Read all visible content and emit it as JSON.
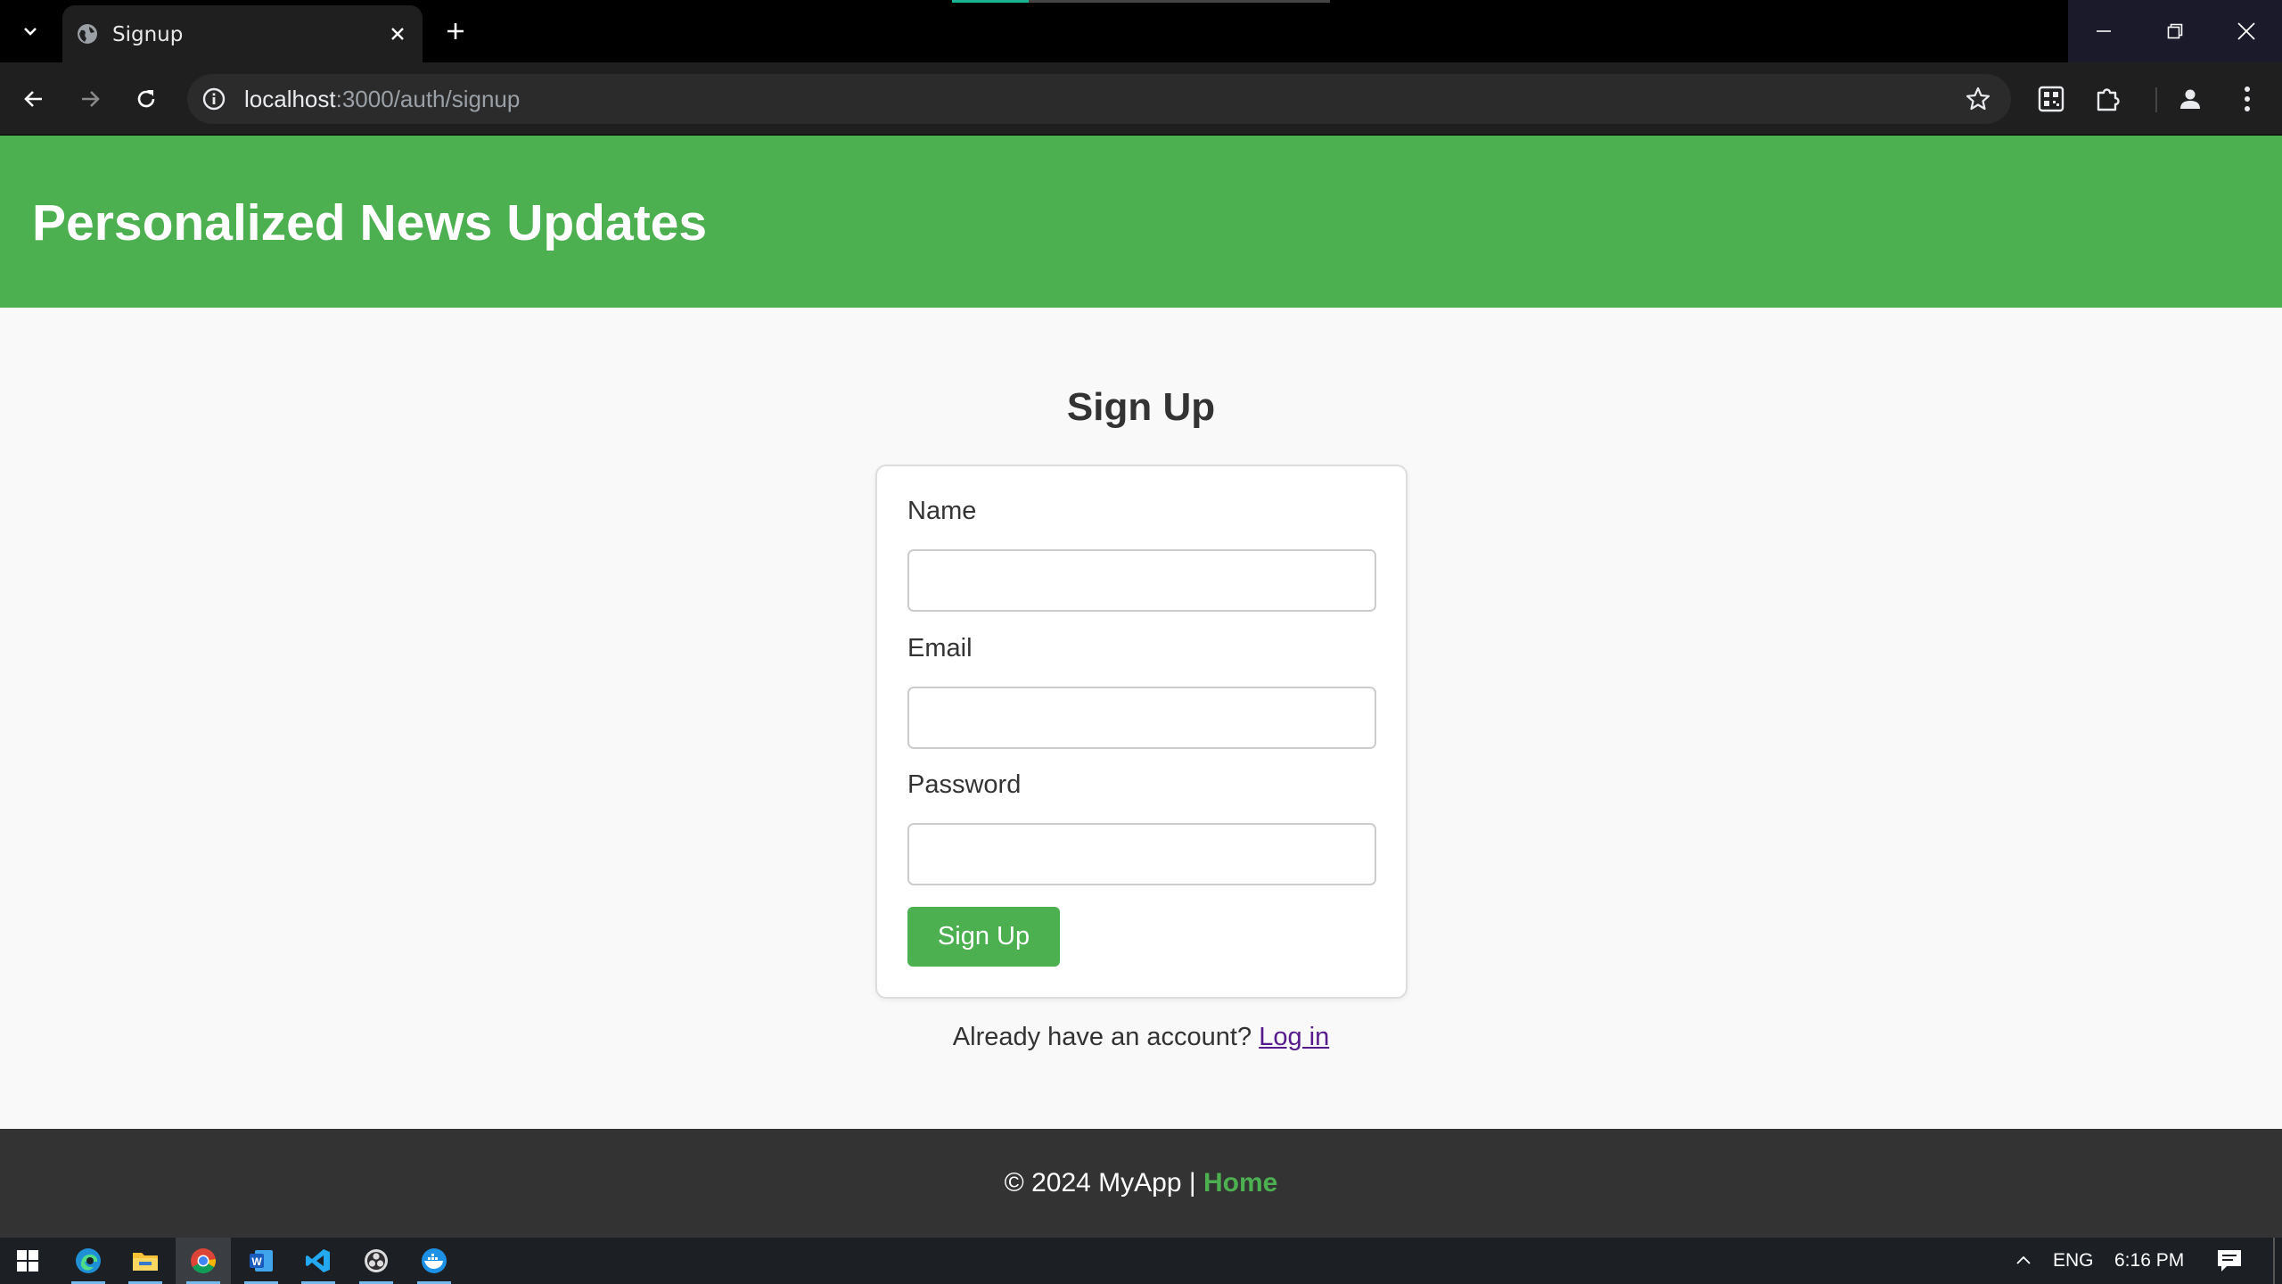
{
  "browser": {
    "tab_title": "Signup",
    "url_host": "localhost",
    "url_rest": ":3000/auth/signup"
  },
  "site": {
    "title": "Personalized News Updates",
    "brand_color": "#4caf50"
  },
  "signup": {
    "heading": "Sign Up",
    "name_label": "Name",
    "email_label": "Email",
    "password_label": "Password",
    "name_value": "",
    "email_value": "",
    "password_value": "",
    "submit_label": "Sign Up",
    "login_prompt": "Already have an account?",
    "login_link": "Log in"
  },
  "footer": {
    "copyright": "© 2024 MyApp |",
    "home_link": "Home"
  },
  "taskbar": {
    "language": "ENG",
    "time": "6:16 PM",
    "apps": [
      "start-icon",
      "edge-icon",
      "file-explorer-icon",
      "chrome-icon",
      "word-icon",
      "vscode-icon",
      "obs-icon",
      "docker-icon"
    ]
  }
}
